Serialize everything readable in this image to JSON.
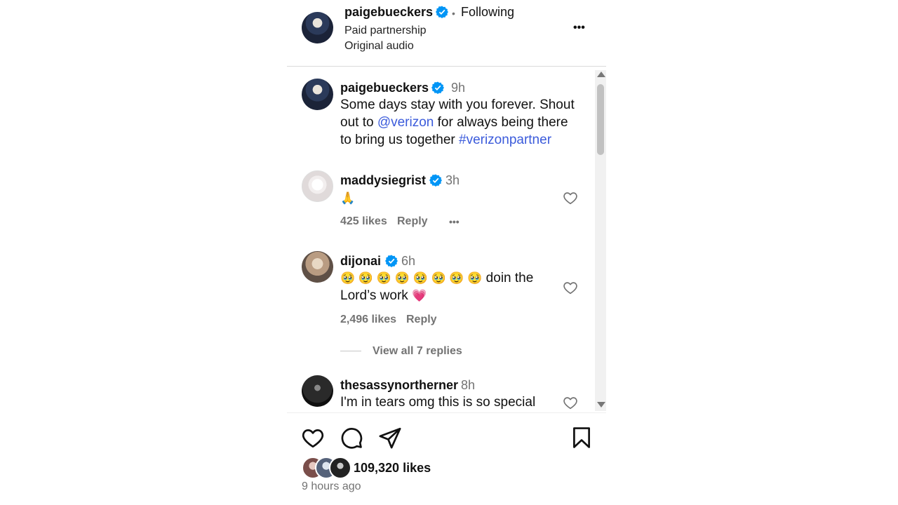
{
  "header": {
    "username": "paigebueckers",
    "separator": "•",
    "follow_status": "Following",
    "line1": "Paid partnership",
    "line2": "Original audio",
    "more_label": "•••"
  },
  "caption": {
    "username": "paigebueckers",
    "time": "9h",
    "text_part1": "Some days stay with you forever. Shout",
    "text_part2_prefix": "out to ",
    "mention": "@verizon",
    "text_part2_suffix": " for always being there",
    "text_part3_prefix": "to bring us together ",
    "hashtag": "#verizonpartner"
  },
  "comments": [
    {
      "username": "maddysiegrist",
      "time": "3h",
      "text": "🙏",
      "likes": "425 likes",
      "reply_label": "Reply",
      "more_label": "•••"
    },
    {
      "username": "dijonai",
      "time": "6h",
      "emojis": "🥹 🥹 🥹 🥹 🥹 🥹 🥹 🥹",
      "text_after": " doin the",
      "text_line2": "Lord’s work ",
      "heart_emoji": "💗",
      "likes": "2,496 likes",
      "reply_label": "Reply",
      "view_replies": "View all 7 replies"
    },
    {
      "username": "thesassynortherner",
      "time": "8h",
      "text": "I'm in tears omg this is so special"
    }
  ],
  "footer": {
    "likes": "109,320 likes",
    "posted": "9 hours ago"
  },
  "colors": {
    "verified": "#0095f6",
    "link": "#3b5bdb",
    "muted": "#737373"
  },
  "icons": [
    "heart-icon",
    "comment-icon",
    "share-icon",
    "bookmark-icon",
    "verified-icon",
    "more-icon"
  ]
}
